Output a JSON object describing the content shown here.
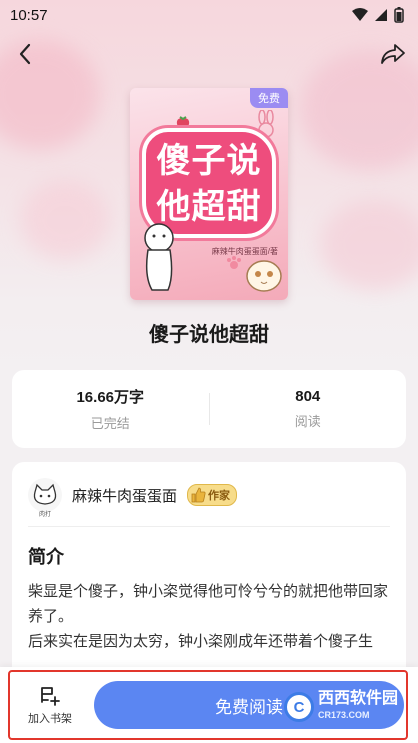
{
  "status_bar": {
    "time": "10:57"
  },
  "cover": {
    "badge": "免费",
    "title_line1": "傻子说",
    "title_line2": "他超甜",
    "author_credit": "麻辣牛肉蛋蛋面/著"
  },
  "book": {
    "title": "傻子说他超甜",
    "word_count": "16.66万字",
    "status": "已完结",
    "reads": "804",
    "reads_label": "阅读"
  },
  "author": {
    "name": "麻辣牛肉蛋蛋面",
    "tag": "作家",
    "avatar_caption": "肉打"
  },
  "intro": {
    "heading": "简介",
    "paragraph1": "柴显是个傻子，钟小栥觉得他可怜兮兮的就把他带回家养了。",
    "paragraph2": "后来实在是因为太穷，钟小栥刚成年还带着个傻子生"
  },
  "bottom_bar": {
    "shelf_label": "加入书架",
    "read_label": "免费阅读"
  },
  "watermark": {
    "logo_letter": "C",
    "main": "西西软件园",
    "sub": "CR173.COM"
  },
  "colors": {
    "accent": "#5b86f2",
    "highlight_border": "#e2362c",
    "badge": "#9b8cf2",
    "cover_title": "#ee4d7d"
  }
}
